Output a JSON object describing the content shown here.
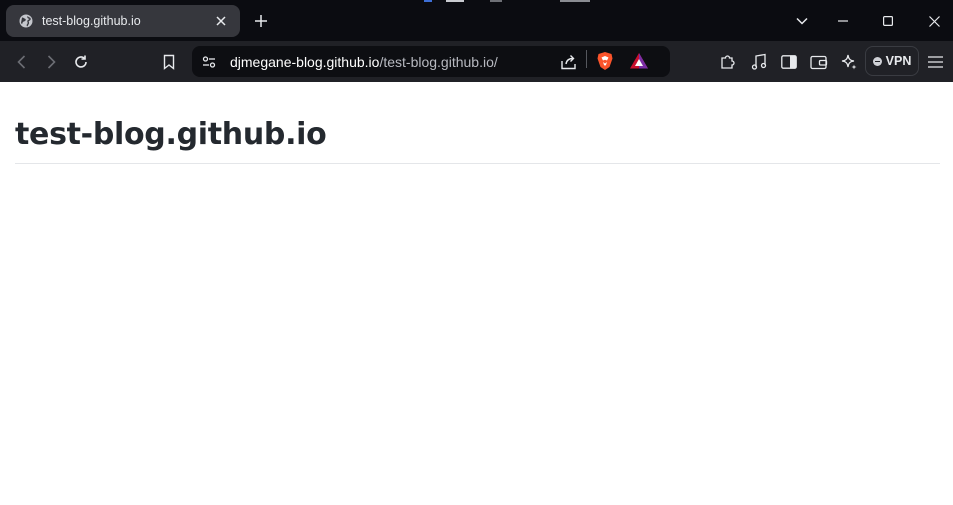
{
  "tab": {
    "title": "test-blog.github.io",
    "favicon": "globe-icon"
  },
  "omnibox": {
    "url_host": "djmegane-blog.github.io",
    "url_path": "/test-blog.github.io/"
  },
  "toolbar": {
    "vpn_label": "VPN"
  },
  "page": {
    "title": "test-blog.github.io"
  },
  "colors": {
    "tabstrip_bg": "#0b0c11",
    "active_tab_bg": "#36373d",
    "toolbar_bg": "#202126",
    "omnibox_bg": "#0d0e12",
    "brave_shield": "#fb542b",
    "rewards_triangle": "#c8102e",
    "page_title": "#24292f"
  }
}
